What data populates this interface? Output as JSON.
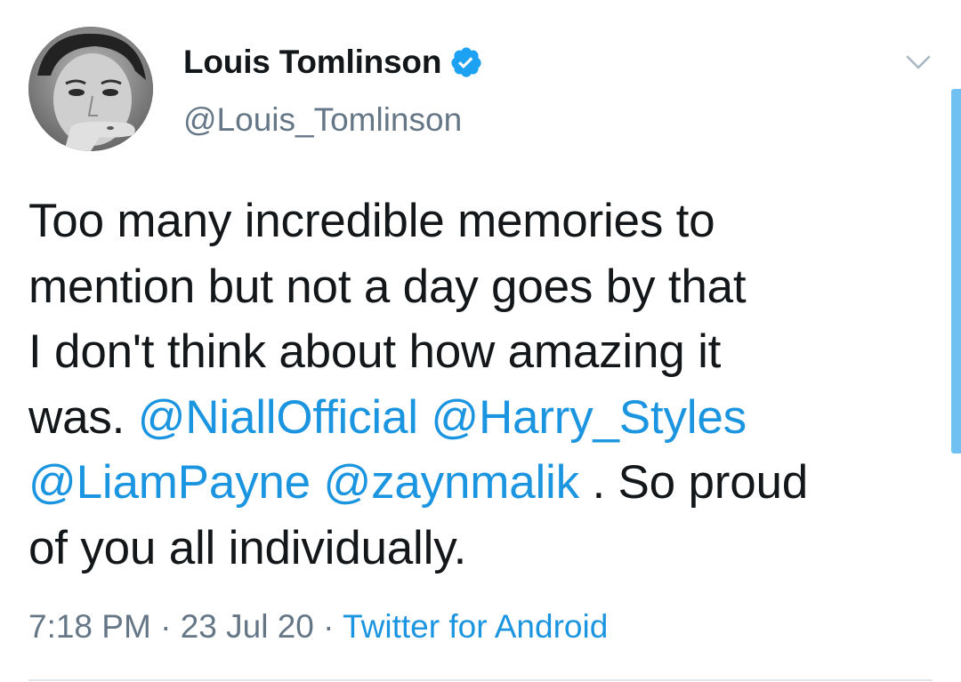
{
  "user": {
    "display_name": "Louis Tomlinson",
    "handle": "@Louis_Tomlinson",
    "verified": true,
    "avatar_icon": "avatar-photo"
  },
  "tweet": {
    "lines": [
      [
        {
          "text": "Too many incredible memories to",
          "type": "text"
        }
      ],
      [
        {
          "text": "mention but not a day goes by that",
          "type": "text"
        }
      ],
      [
        {
          "text": "I don't think about how amazing it",
          "type": "text"
        }
      ],
      [
        {
          "text": "was. ",
          "type": "text"
        },
        {
          "text": "@NiallOfficial",
          "type": "mention"
        },
        {
          "text": " ",
          "type": "text"
        },
        {
          "text": "@Harry_Styles",
          "type": "mention"
        }
      ],
      [
        {
          "text": "@LiamPayne",
          "type": "mention"
        },
        {
          "text": " ",
          "type": "text"
        },
        {
          "text": "@zaynmalik",
          "type": "mention"
        },
        {
          "text": " . So proud",
          "type": "text"
        }
      ],
      [
        {
          "text": "of you all individually.",
          "type": "text"
        }
      ]
    ],
    "time": "7:18 PM",
    "separator": "·",
    "date": "23 Jul 20",
    "source": "Twitter for Android"
  },
  "icons": {
    "verified": "verified-badge-icon",
    "menu": "chevron-down-icon"
  },
  "colors": {
    "text": "#14171a",
    "secondary": "#657786",
    "link": "#1b95e0",
    "verified": "#1da1f2"
  }
}
